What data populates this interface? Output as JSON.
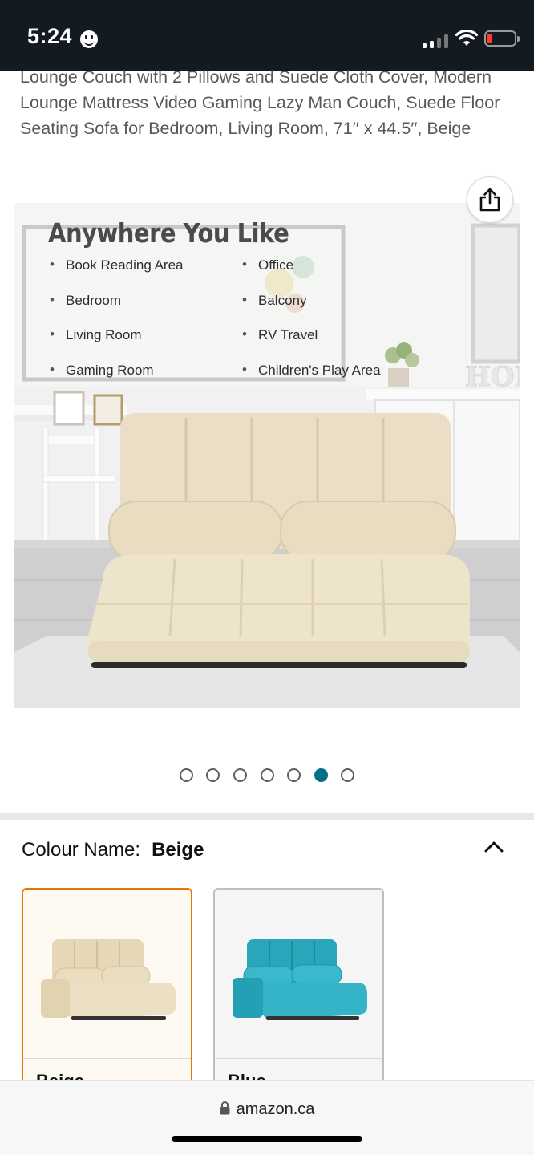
{
  "status_bar": {
    "time": "5:24",
    "battery_color": "#ff3b30"
  },
  "product": {
    "title": "Lounge Couch with 2 Pillows and Suede Cloth Cover, Modern Lounge Mattress Video Gaming Lazy Man Couch, Suede Floor Seating Sofa for Bedroom, Living Room, 71′′ x 44.5′′, Beige"
  },
  "share": {
    "icon": "share-icon"
  },
  "image": {
    "heading": "Anywhere You Like",
    "features_left": [
      "Book Reading Area",
      "Bedroom",
      "Living Room",
      "Gaming Room"
    ],
    "features_right": [
      "Office",
      "Balcony",
      "RV Travel",
      "Children's Play Area"
    ],
    "wall_letters": "HOME"
  },
  "carousel": {
    "total": 7,
    "active_index": 5,
    "active_color": "#007185"
  },
  "colour": {
    "label": "Colour Name:",
    "value": "Beige",
    "expanded_icon": "chevron-up-icon",
    "swatches": [
      {
        "label": "Beige",
        "color": "#efe6cf",
        "selected": true
      },
      {
        "label": "Blue",
        "color": "#3ab2c4",
        "selected": false
      }
    ]
  },
  "browser": {
    "url": "amazon.ca",
    "lock_icon": "lock-icon"
  }
}
